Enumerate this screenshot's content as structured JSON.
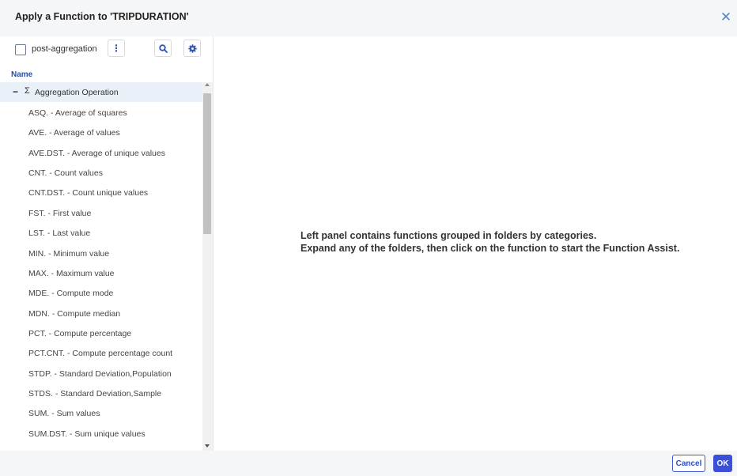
{
  "dialog": {
    "title": "Apply a Function to 'TRIPDURATION'",
    "close_icon": "close-icon"
  },
  "toolbar": {
    "checkbox_label": "post-aggregation",
    "checkbox_checked": false,
    "more_icon": "more-vertical-icon",
    "search_icon": "search-icon",
    "settings_icon": "gear-icon"
  },
  "tree": {
    "column_header": "Name",
    "folder": {
      "expand_symbol": "−",
      "icon": "Σ",
      "label": "Aggregation Operation",
      "expanded": true
    },
    "items": [
      "ASQ. - Average of squares",
      "AVE. - Average of values",
      "AVE.DST. - Average of unique values",
      "CNT. - Count values",
      "CNT.DST. - Count unique values",
      "FST. - First value",
      "LST. - Last value",
      "MIN. - Minimum value",
      "MAX. - Maximum value",
      "MDE. - Compute mode",
      "MDN. - Compute median",
      "PCT. - Compute percentage",
      "PCT.CNT. - Compute percentage count",
      "STDP. - Standard Deviation,Population",
      "STDS. - Standard Deviation,Sample",
      "SUM. - Sum values",
      "SUM.DST. - Sum unique values"
    ]
  },
  "info": {
    "line1": "Left panel contains functions grouped in folders by categories.",
    "line2": "Expand any of the folders, then click on the function to start the Function Assist."
  },
  "footer": {
    "cancel_label": "Cancel",
    "ok_label": "OK"
  },
  "colors": {
    "accent": "#3b4fd8",
    "header_bg": "#f5f6f8",
    "folder_bg": "#e9f0f8",
    "link_blue": "#2a4fa8"
  }
}
